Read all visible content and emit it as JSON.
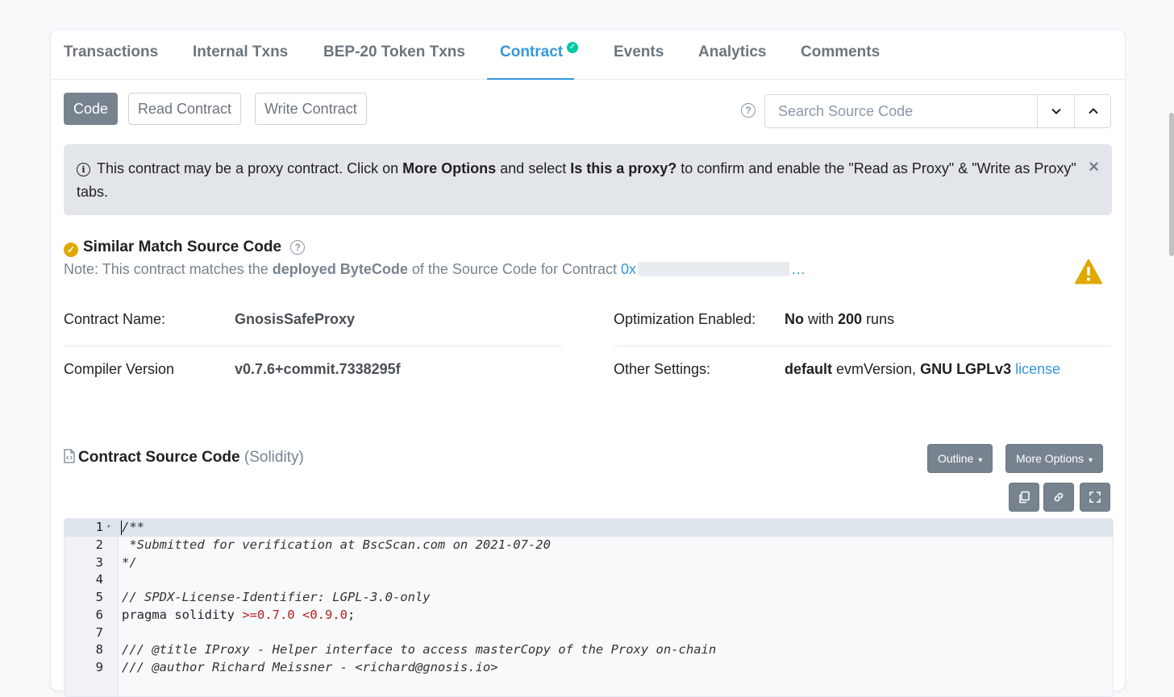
{
  "tabs": [
    {
      "label": "Transactions"
    },
    {
      "label": "Internal Txns"
    },
    {
      "label": "BEP-20 Token Txns"
    },
    {
      "label": "Contract"
    },
    {
      "label": "Events"
    },
    {
      "label": "Analytics"
    },
    {
      "label": "Comments"
    }
  ],
  "active_tab": "Contract",
  "subtabs": {
    "code": "Code",
    "read": "Read Contract",
    "write": "Write Contract"
  },
  "search": {
    "placeholder": "Search Source Code",
    "value": ""
  },
  "alert": {
    "text1": "This contract may be a proxy contract. Click on ",
    "bold1": "More Options",
    "text2": " and select ",
    "bold2": "Is this a proxy?",
    "text3": " to confirm and enable the \"Read as Proxy\" & \"Write as Proxy\" tabs."
  },
  "match": {
    "title": "Similar Match Source Code",
    "note_prefix": "Note: This contract matches the ",
    "note_bold": "deployed ByteCode",
    "note_suffix": " of the Source Code for Contract ",
    "address_prefix": "0x",
    "address_suffix": "…"
  },
  "info": {
    "contract_name_label": "Contract Name:",
    "contract_name": "GnosisSafeProxy",
    "compiler_label": "Compiler Version",
    "compiler": "v0.7.6+commit.7338295f",
    "optimization_label": "Optimization Enabled:",
    "optimization_bold": "No",
    "optimization_mid": " with ",
    "optimization_runs": "200",
    "optimization_suffix": " runs",
    "settings_label": "Other Settings:",
    "settings_bold1": "default",
    "settings_mid": " evmVersion, ",
    "settings_bold2": "GNU LGPLv3",
    "settings_link": "license"
  },
  "source": {
    "title": "Contract Source Code",
    "lang": "(Solidity)",
    "outline": "Outline",
    "more_options": "More Options"
  },
  "code_lines": [
    {
      "n": "1",
      "text": "/**"
    },
    {
      "n": "2",
      "text": " *Submitted for verification at BscScan.com on 2021-07-20"
    },
    {
      "n": "3",
      "text": "*/"
    },
    {
      "n": "4",
      "text": ""
    },
    {
      "n": "5",
      "text": "// SPDX-License-Identifier: LGPL-3.0-only"
    },
    {
      "n": "6",
      "text": "pragma solidity >=0.7.0 <0.9.0;"
    },
    {
      "n": "7",
      "text": ""
    },
    {
      "n": "8",
      "text": "/// @title IProxy - Helper interface to access masterCopy of the Proxy on-chain"
    },
    {
      "n": "9",
      "text": "/// @author Richard Meissner - <richard@gnosis.io>"
    }
  ],
  "icons": [
    "check-circle-icon",
    "help-icon",
    "chevron-down-icon",
    "chevron-up-icon",
    "info-icon",
    "close-icon",
    "warning-icon",
    "file-code-icon",
    "copy-icon",
    "link-icon",
    "fullscreen-icon"
  ],
  "colors": {
    "accent": "#3498db",
    "warning": "#e0a800",
    "verified": "#00c9a7",
    "button_dark": "#77838f"
  }
}
